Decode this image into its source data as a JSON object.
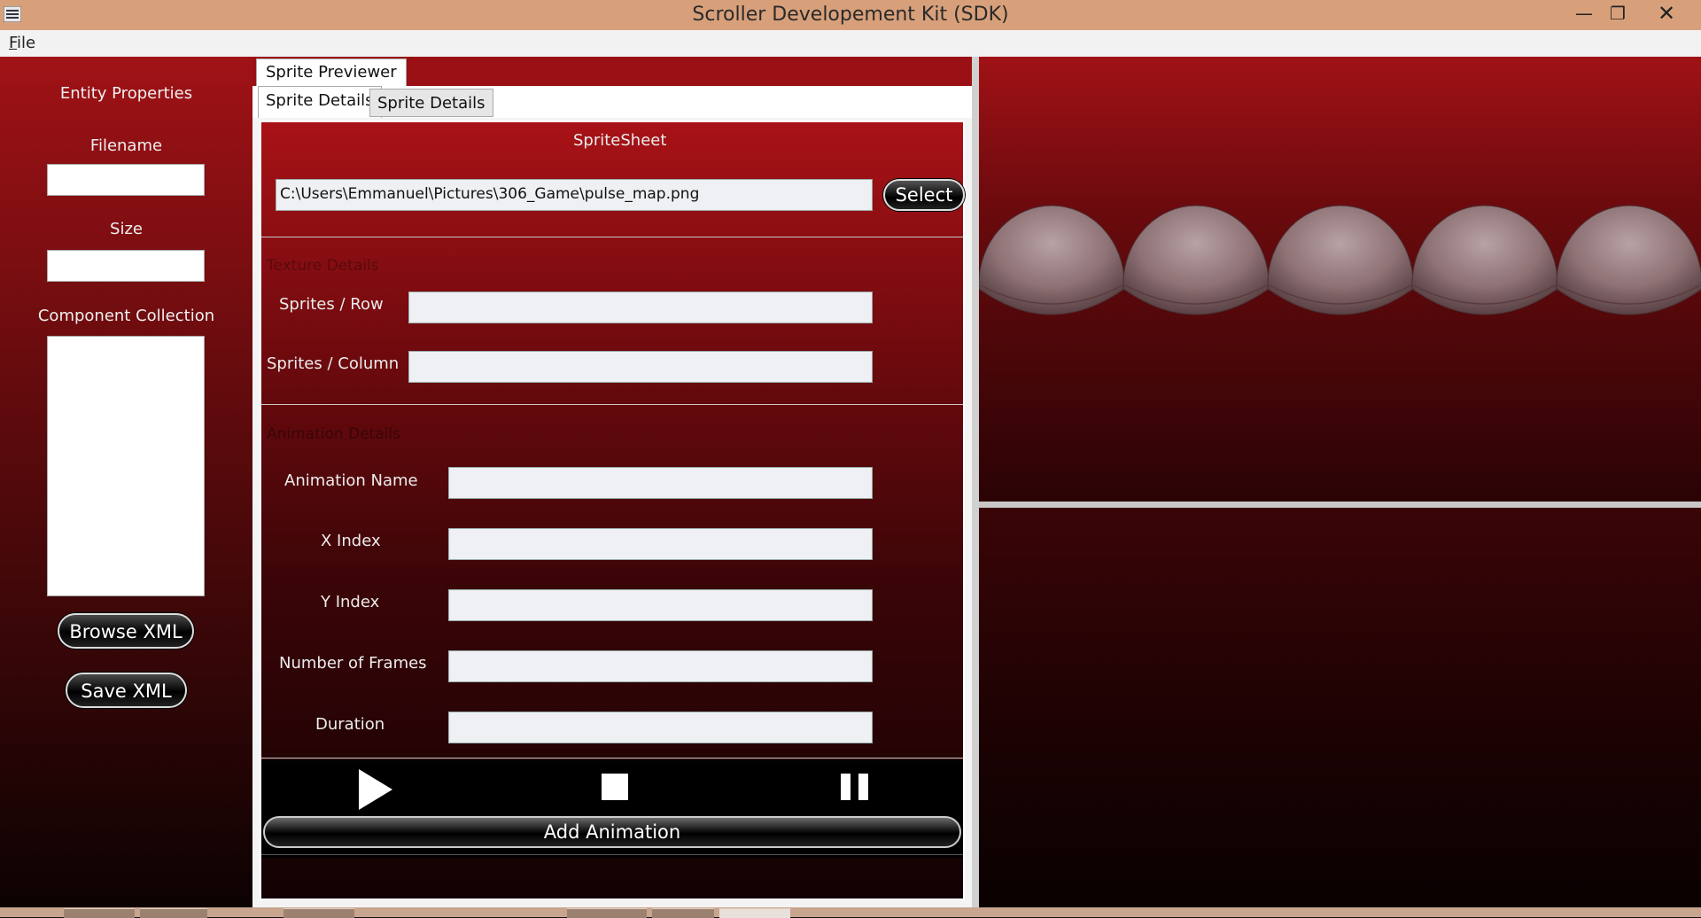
{
  "window": {
    "title": "Scroller Developement Kit (SDK)",
    "min_glyph": "—",
    "max_glyph": "❐",
    "close_glyph": "✕"
  },
  "menu": {
    "file_label_u": "F",
    "file_label_rest": "ile"
  },
  "left_panel": {
    "entity_properties": "Entity Properties",
    "filename_label": "Filename",
    "filename_value": "",
    "size_label": "Size",
    "size_value": "",
    "component_collection_label": "Component Collection",
    "browse_xml": "Browse XML",
    "save_xml": "Save XML"
  },
  "middle": {
    "outer_tab": "Sprite Previewer",
    "inner_tabs": [
      "Sprite Details",
      "Sprite Details"
    ],
    "spritesheet_label": "SpriteSheet",
    "spritesheet_path": "C:\\Users\\Emmanuel\\Pictures\\306_Game\\pulse_map.png",
    "select_button": "Select",
    "texture_heading": "Texture Details",
    "sprites_row_label": "Sprites / Row",
    "sprites_row_value": "",
    "sprites_col_label": "Sprites / Column",
    "sprites_col_value": "",
    "animation_heading": "Animation Details",
    "animation_name_label": "Animation Name",
    "x_index_label": "X Index",
    "y_index_label": "Y Index",
    "frames_label": "Number of Frames",
    "duration_label": "Duration",
    "add_animation": "Add Animation"
  },
  "icons": [
    "menu-icon",
    "play-icon",
    "stop-icon",
    "pause-icon"
  ],
  "colors": {
    "accent_red": "#a01216",
    "titlebar": "#d8a07a"
  }
}
